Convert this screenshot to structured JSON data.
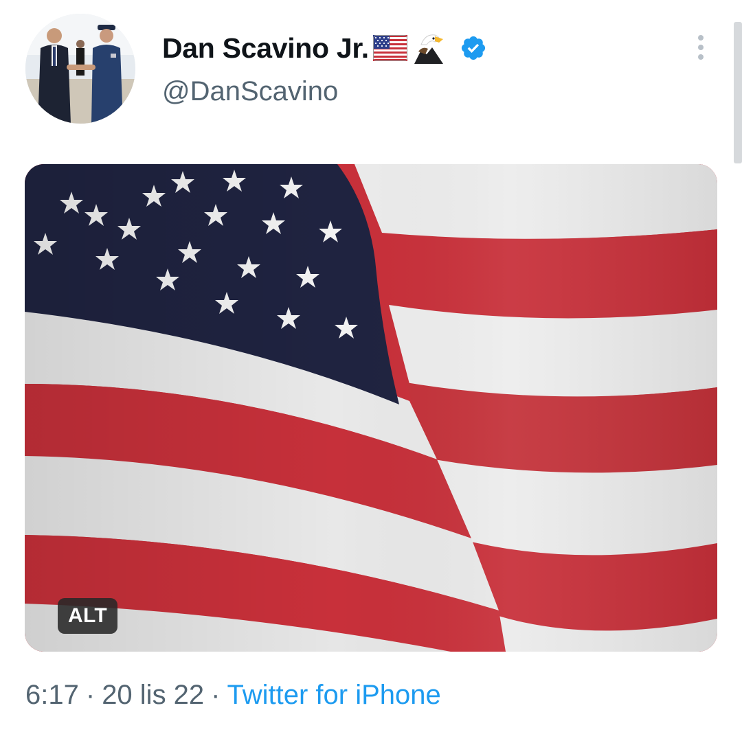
{
  "tweet": {
    "author": {
      "display_name": "Dan Scavino Jr.",
      "handle": "@DanScavino",
      "name_emojis": [
        "us-flag-icon",
        "eagle-icon"
      ],
      "verified": true,
      "avatar_icon": "avatar"
    },
    "media": {
      "type": "image",
      "subject": "american-flag",
      "alt_badge": "ALT"
    },
    "meta": {
      "time": "6:17",
      "separator": "·",
      "date": "20 lis 22",
      "source": "Twitter for iPhone"
    },
    "more_icon": "more-vertical-icon"
  },
  "colors": {
    "text_primary": "#0f1419",
    "text_secondary": "#536471",
    "link": "#1d9bf0",
    "verified": "#1d9bf0",
    "flag_red": "#c8303a",
    "flag_blue": "#1f2340",
    "flag_white": "#eeeeee"
  }
}
